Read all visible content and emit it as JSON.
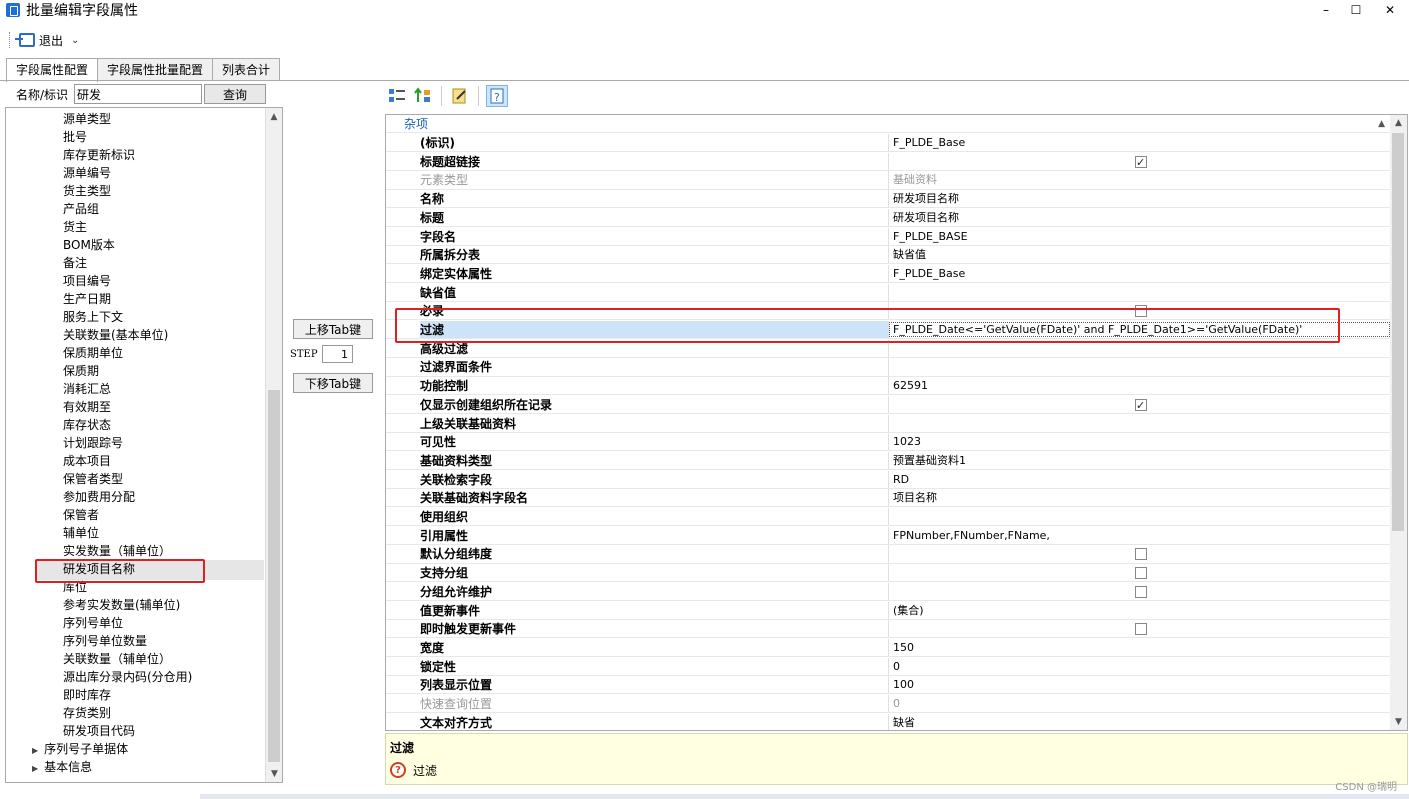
{
  "window": {
    "title": "批量编辑字段属性",
    "minimize": "–",
    "maximize": "☐",
    "close": "✕"
  },
  "toolbar": {
    "exit_label": "退出",
    "exit_menu": "⌄"
  },
  "tabs": [
    "字段属性配置",
    "字段属性批量配置",
    "列表合计"
  ],
  "search": {
    "label": "名称/标识",
    "value": "研发",
    "button": "查询"
  },
  "tree": {
    "items": [
      "源单类型",
      "批号",
      "库存更新标识",
      "源单编号",
      "货主类型",
      "产品组",
      "货主",
      "BOM版本",
      "备注",
      "项目编号",
      "生产日期",
      "服务上下文",
      "关联数量(基本单位)",
      "保质期单位",
      "保质期",
      "消耗汇总",
      "有效期至",
      "库存状态",
      "计划跟踪号",
      "成本项目",
      "保管者类型",
      "参加费用分配",
      "保管者",
      "辅单位",
      "实发数量（辅单位）",
      "研发项目名称",
      "库位",
      "参考实发数量(辅单位)",
      "序列号单位",
      "序列号单位数量",
      "关联数量（辅单位）",
      "源出库分录内码(分仓用)",
      "即时库存",
      "存货类别",
      "研发项目代码"
    ],
    "nodes": [
      "序列号子单据体",
      "基本信息"
    ],
    "node_glyph": "▶"
  },
  "middle": {
    "up_button": "上移Tab键",
    "step_label": "STEP",
    "step_value": "1",
    "down_button": "下移Tab键"
  },
  "grid": {
    "category": "杂项",
    "rows": [
      {
        "name": "(标识)",
        "value": "F_PLDE_Base"
      },
      {
        "name": "标题超链接",
        "value": "",
        "checkbox": "checked"
      },
      {
        "name": "元素类型",
        "value": "基础资料",
        "disabled": true
      },
      {
        "name": "名称",
        "value": "研发项目名称"
      },
      {
        "name": "标题",
        "value": "研发项目名称"
      },
      {
        "name": "字段名",
        "value": "F_PLDE_BASE"
      },
      {
        "name": "所属拆分表",
        "value": "缺省值"
      },
      {
        "name": "绑定实体属性",
        "value": "F_PLDE_Base"
      },
      {
        "name": "缺省值",
        "value": ""
      },
      {
        "name": "必录",
        "value": "",
        "checkbox": "unchecked"
      },
      {
        "name": "过滤",
        "value": "F_PLDE_Date<='GetValue(FDate)' and F_PLDE_Date1>='GetValue(FDate)'",
        "selected": true
      },
      {
        "name": "高级过滤",
        "value": ""
      },
      {
        "name": "过滤界面条件",
        "value": ""
      },
      {
        "name": "功能控制",
        "value": "62591"
      },
      {
        "name": "仅显示创建组织所在记录",
        "value": "",
        "checkbox": "checked"
      },
      {
        "name": "上级关联基础资料",
        "value": ""
      },
      {
        "name": "可见性",
        "value": "1023"
      },
      {
        "name": "基础资料类型",
        "value": "预置基础资料1"
      },
      {
        "name": "关联检索字段",
        "value": "RD"
      },
      {
        "name": "关联基础资料字段名",
        "value": "项目名称"
      },
      {
        "name": "使用组织",
        "value": ""
      },
      {
        "name": "引用属性",
        "value": "FPNumber,FNumber,FName,"
      },
      {
        "name": "默认分组纬度",
        "value": "",
        "checkbox": "unchecked"
      },
      {
        "name": "支持分组",
        "value": "",
        "checkbox": "unchecked"
      },
      {
        "name": "分组允许维护",
        "value": "",
        "checkbox": "unchecked"
      },
      {
        "name": "值更新事件",
        "value": "(集合)"
      },
      {
        "name": "即时触发更新事件",
        "value": "",
        "checkbox": "unchecked"
      },
      {
        "name": "宽度",
        "value": "150"
      },
      {
        "name": "锁定性",
        "value": "0"
      },
      {
        "name": "列表显示位置",
        "value": "100"
      },
      {
        "name": "快速查询位置",
        "value": "0",
        "disabled": true
      },
      {
        "name": "文本对齐方式",
        "value": "缺省"
      },
      {
        "name": "",
        "value": ""
      }
    ]
  },
  "description": {
    "title": "过滤",
    "icon": "?",
    "text": "过滤"
  },
  "watermark": "CSDN @瑞明",
  "colors": {
    "highlight": "#e02020",
    "selection": "#cde3f7",
    "category": "#1a5fb4"
  }
}
